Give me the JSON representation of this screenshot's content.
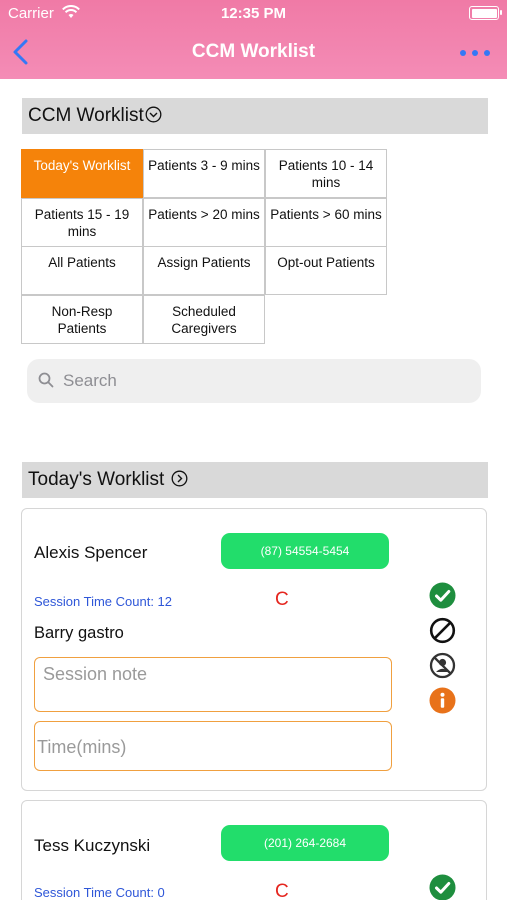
{
  "status_bar": {
    "carrier": "Carrier",
    "time": "12:35 PM"
  },
  "nav": {
    "title": "CCM Worklist",
    "back_icon": "chevron-left-icon",
    "more_icon": "more-dots-icon"
  },
  "worklist_header": {
    "title": "CCM Worklist",
    "icon": "chevron-down-circle-icon"
  },
  "filters": [
    {
      "label": "Today's Worklist",
      "selected": true
    },
    {
      "label": "Patients 3 - 9 mins",
      "selected": false
    },
    {
      "label": "Patients 10 - 14 mins",
      "selected": false
    },
    {
      "label": "Patients 15 - 19 mins",
      "selected": false
    },
    {
      "label": "Patients > 20 mins",
      "selected": false
    },
    {
      "label": "Patients > 60 mins",
      "selected": false
    },
    {
      "label": "All Patients",
      "selected": false
    },
    {
      "label": "Assign Patients",
      "selected": false
    },
    {
      "label": "Opt-out Patients",
      "selected": false
    },
    {
      "label": "Non-Resp Patients",
      "selected": false
    },
    {
      "label": "Scheduled Caregivers",
      "selected": false
    }
  ],
  "search": {
    "placeholder": "Search",
    "icon": "search-icon"
  },
  "today_header": {
    "title": "Today's Worklist",
    "icon": "chevron-right-circle-icon"
  },
  "colors": {
    "nav": "#f07aa6",
    "selected_filter": "#f5830a",
    "phone_button": "#22dd6b",
    "session_text": "#2f57d8",
    "flag": "#e5261f",
    "field_border": "#f0a040"
  },
  "patients": [
    {
      "name": "Alexis Spencer",
      "phone": "(87) 54554-5454",
      "session_time_count": "Session Time Count: 12",
      "flag": "C",
      "doctor": "Barry gastro",
      "note_placeholder": "Session note",
      "time_placeholder": "Time(mins)",
      "actions": [
        "check-circle-icon",
        "block-icon",
        "person-off-icon",
        "info-icon"
      ]
    },
    {
      "name": "Tess Kuczynski",
      "phone": "(201) 264-2684",
      "session_time_count": "Session Time Count: 0",
      "flag": "C",
      "actions": [
        "check-circle-icon"
      ]
    }
  ]
}
